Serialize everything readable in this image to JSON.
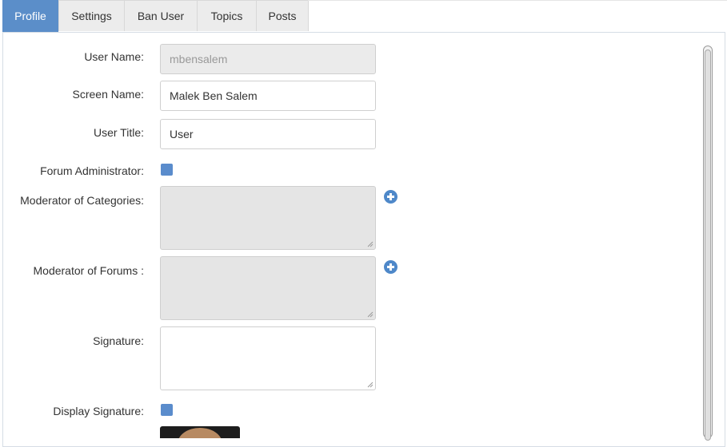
{
  "tabs": [
    {
      "label": "Profile",
      "active": true
    },
    {
      "label": "Settings"
    },
    {
      "label": "Ban User"
    },
    {
      "label": "Topics"
    },
    {
      "label": "Posts"
    }
  ],
  "form": {
    "user_name": {
      "label": "User Name:",
      "value": "mbensalem",
      "disabled": true
    },
    "screen_name": {
      "label": "Screen Name:",
      "value": "Malek Ben Salem"
    },
    "user_title": {
      "label": "User Title:",
      "value": "User"
    },
    "forum_admin": {
      "label": "Forum Administrator:",
      "checked": false
    },
    "mod_categories": {
      "label": "Moderator of Categories:",
      "value": ""
    },
    "mod_forums": {
      "label": "Moderator of Forums :",
      "value": ""
    },
    "signature": {
      "label": "Signature:",
      "value": ""
    },
    "display_signature": {
      "label": "Display Signature:",
      "checked": false
    }
  },
  "icons": {
    "add": "plus-circle-icon",
    "resize": "resize-grip-icon"
  },
  "colors": {
    "accent": "#5b8ec9",
    "checkbox": "#5a8ccc",
    "disabled_bg": "#ebebeb"
  }
}
